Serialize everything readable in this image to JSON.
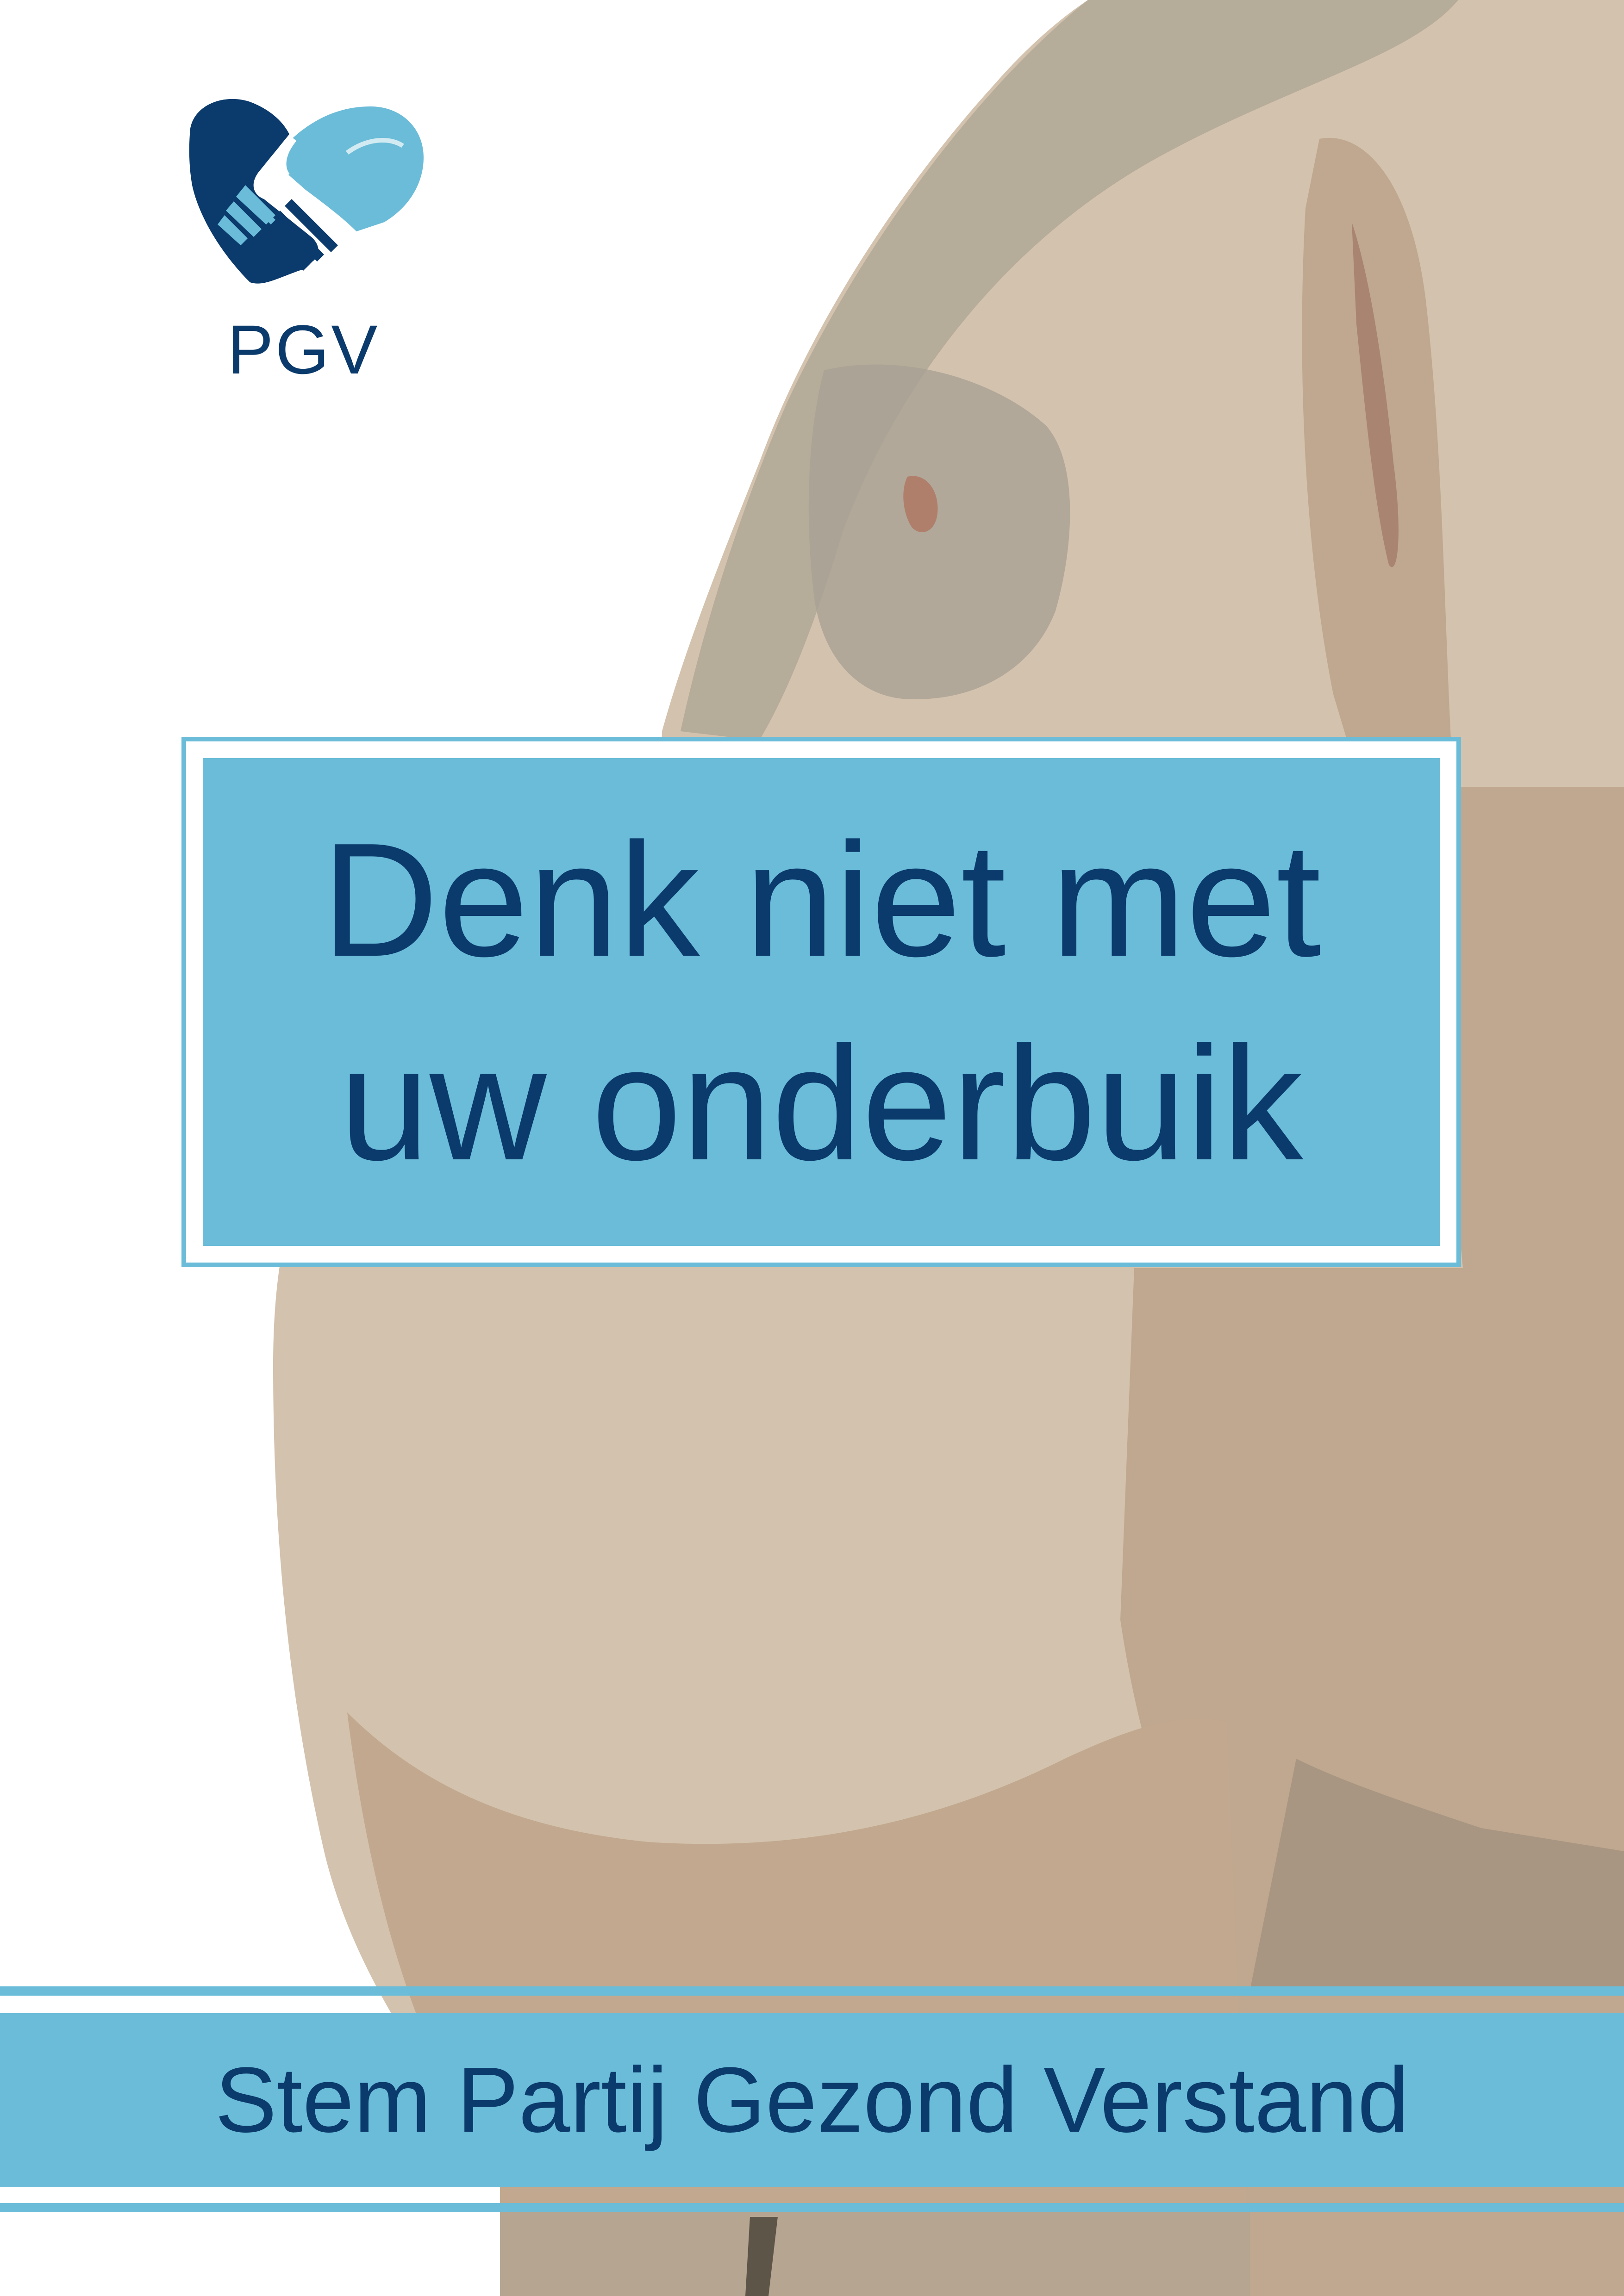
{
  "logo": {
    "text": "PGV",
    "icon": "handshake-heart-icon"
  },
  "headline": {
    "line1": "Denk niet met",
    "line2": "uw onderbuik"
  },
  "footer": {
    "text": "Stem Partij Gezond Verstand"
  },
  "colors": {
    "navy": "#0b3a6c",
    "accent_blue": "#6abcd8",
    "background": "#ffffff"
  }
}
